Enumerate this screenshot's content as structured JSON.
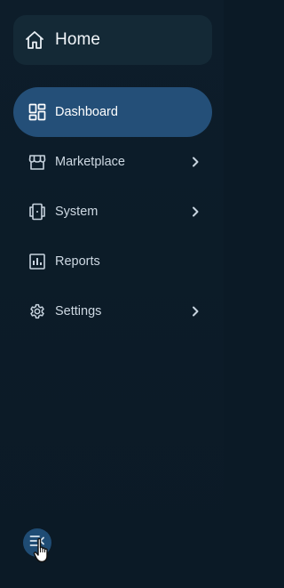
{
  "home": {
    "label": "Home",
    "icon": "home-icon"
  },
  "nav": {
    "items": [
      {
        "label": "Dashboard",
        "icon": "dashboard-icon",
        "active": true,
        "has_submenu": false
      },
      {
        "label": "Marketplace",
        "icon": "store-icon",
        "active": false,
        "has_submenu": true
      },
      {
        "label": "System",
        "icon": "devices-icon",
        "active": false,
        "has_submenu": true
      },
      {
        "label": "Reports",
        "icon": "bar-chart-icon",
        "active": false,
        "has_submenu": false
      },
      {
        "label": "Settings",
        "icon": "gear-icon",
        "active": false,
        "has_submenu": true
      }
    ]
  },
  "collapse_button": {
    "icon": "collapse-menu-icon"
  },
  "colors": {
    "background": "#0b1a26",
    "card": "#142936",
    "active": "#244f78",
    "collapse_button": "#1f4c74"
  }
}
